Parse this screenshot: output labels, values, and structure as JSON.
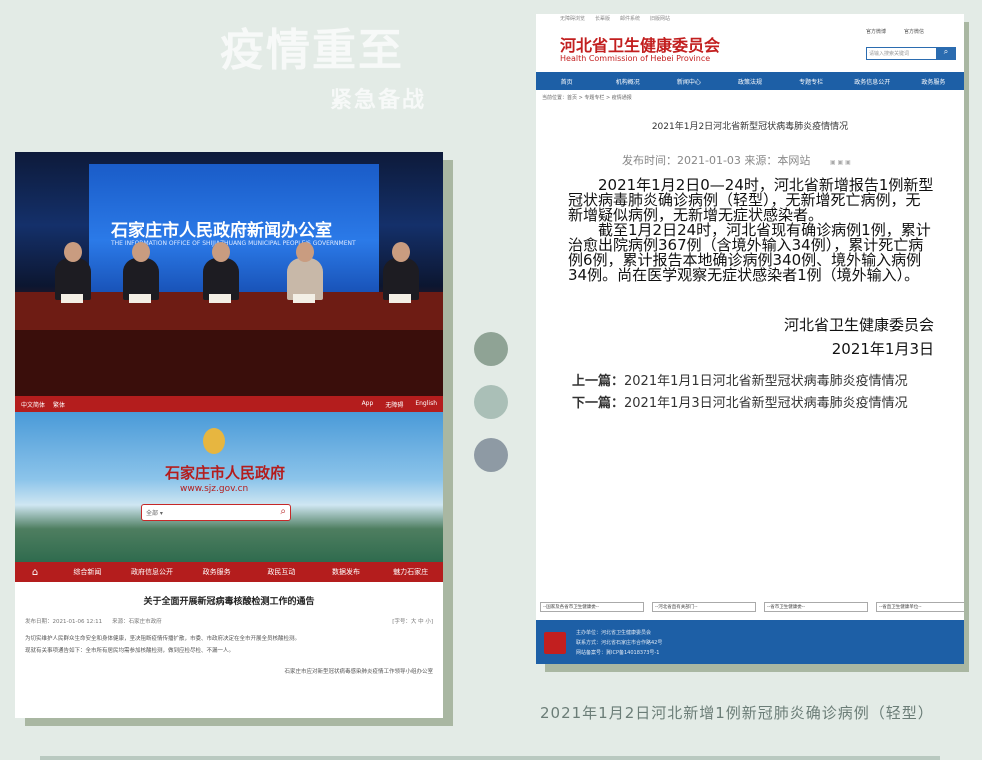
{
  "headline": {
    "title": "疫情重至",
    "subtitle": "紧急备战"
  },
  "left_photo": {
    "screen_title": "石家庄市人民政府新闻办公室",
    "screen_sub": "THE INFORMATION OFFICE OF SHIJIAZHUANG MUNICIPAL PEOPLE'S GOVERNMENT"
  },
  "left_site": {
    "topbar": {
      "left": [
        "中文简体",
        "繁体"
      ],
      "right": [
        "App",
        "无障碍",
        "English"
      ]
    },
    "site_name": "石家庄市人民政府",
    "site_url": "www.sjz.gov.cn",
    "search_placeholder": "全部 ▾",
    "nav": [
      "综合新闻",
      "政府信息公开",
      "政务服务",
      "政民互动",
      "数据发布",
      "魅力石家庄"
    ],
    "article_title": "关于全面开展新冠病毒核酸检测工作的通告",
    "article_date": "发布日期：2021-01-06 12:11",
    "article_source": "来源：石家庄市政府",
    "article_size": "[字号：大 中 小]",
    "body_lines": [
      "为切实维护人民群众生命安全和身体健康，坚决阻断疫情传播扩散，市委、市政府决定在全市开展全员核酸检测。",
      "现就有关事项通告如下：全市所有居民均需参加核酸检测，做到应检尽检、不漏一人。"
    ],
    "footer": "石家庄市应对新型冠状病毒感染肺炎疫情工作领导小组办公室"
  },
  "dots": [
    {
      "color": "#8fa395"
    },
    {
      "color": "#aabfb7"
    },
    {
      "color": "#8e9aa4"
    }
  ],
  "right_site": {
    "top_links": [
      "无障碍浏览",
      "长辈版",
      "邮件系统",
      "旧版网站"
    ],
    "org_name": "河北省卫生健康委员会",
    "org_en": "Health Commission of Hebei Province",
    "header_links": [
      "官方微博",
      "官方微信"
    ],
    "search_placeholder": "请输入搜索关键词",
    "nav": [
      "首页",
      "机构概况",
      "新闻中心",
      "政策法规",
      "专题专栏",
      "政务信息公开",
      "政务服务"
    ],
    "breadcrumb": "当前位置：首页 > 专题专栏 > 疫情通报",
    "article_title": "2021年1月2日河北省新型冠状病毒肺炎疫情情况",
    "meta": "发布时间：2021-01-03    来源：本网站",
    "paragraphs": [
      "2021年1月2日0—24时，河北省新增报告1例新型冠状病毒肺炎确诊病例（轻型），无新增死亡病例，无新增疑似病例，无新增无症状感染者。",
      "截至1月2日24时，河北省现有确诊病例1例，累计治愈出院病例367例（含境外输入34例），累计死亡病例6例，累计报告本地确诊病例340例、境外输入病例34例。尚在医学观察无症状感染者1例（境外输入）。"
    ],
    "sign_org": "河北省卫生健康委员会",
    "sign_date": "2021年1月3日",
    "prev_label": "上一篇：",
    "prev_title": "2021年1月1日河北省新型冠状病毒肺炎疫情情况",
    "next_label": "下一篇：",
    "next_title": "2021年1月3日河北省新型冠状病毒肺炎疫情情况",
    "selects": [
      "--国家及各省市卫生健康委--",
      "--河北省直有关部门--",
      "--省市卫生健康委--",
      "--省直卫生健康单位--"
    ],
    "footer_lines": [
      "主办单位：河北省卫生健康委员会",
      "联系方式：河北省石家庄市合作路42号",
      "网站备案号：冀ICP备14018373号-1"
    ]
  },
  "caption": "2021年1月2日河北新增1例新冠肺炎确诊病例（轻型）"
}
